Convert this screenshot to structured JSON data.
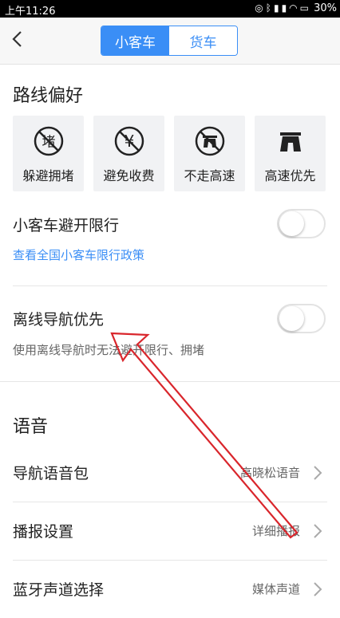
{
  "status_bar": {
    "time": "上午11:26",
    "battery": "30%",
    "icons": [
      "alarm-icon",
      "bluetooth-icon",
      "signal-icon",
      "signal-icon",
      "wifi-icon",
      "battery-charging-icon"
    ]
  },
  "nav": {
    "tabs": [
      {
        "label": "小客车",
        "active": true
      },
      {
        "label": "货车",
        "active": false
      }
    ]
  },
  "route_pref": {
    "title": "路线偏好",
    "options": [
      {
        "label": "躲避拥堵",
        "icon": "avoid-congestion-icon",
        "glyph": "堵"
      },
      {
        "label": "避免收费",
        "icon": "avoid-toll-icon",
        "glyph": "¥"
      },
      {
        "label": "不走高速",
        "icon": "no-highway-icon"
      },
      {
        "label": "高速优先",
        "icon": "highway-first-icon"
      }
    ]
  },
  "restriction": {
    "label": "小客车避开限行",
    "link": "查看全国小客车限行政策",
    "enabled": false
  },
  "offline": {
    "label": "离线导航优先",
    "desc": "使用离线导航时无法避开限行、拥堵",
    "enabled": false
  },
  "voice": {
    "title": "语音",
    "rows": [
      {
        "label": "导航语音包",
        "value": "高晓松语音"
      },
      {
        "label": "播报设置",
        "value": "详细播报"
      },
      {
        "label": "蓝牙声道选择",
        "value": "媒体声道"
      }
    ]
  },
  "colors": {
    "accent": "#3a8ef6",
    "annotation_arrow": "#d9262c"
  }
}
